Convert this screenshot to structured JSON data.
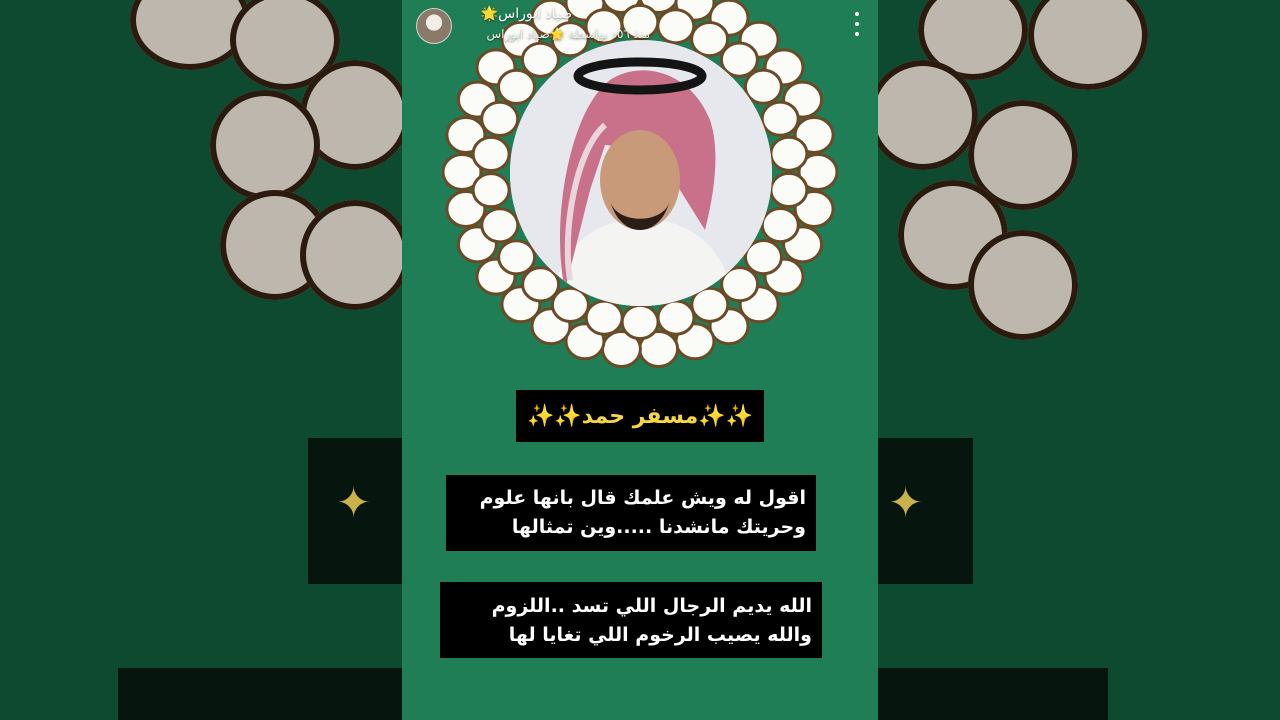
{
  "header": {
    "username": "صياد ابوراس🌟",
    "subline": "منذ ٥٦د بواسطة 🌟صياد ابوراس"
  },
  "card": {
    "name": "✨✨مسفر حمد✨✨"
  },
  "verses": [
    {
      "line1": "اقول له ويش علمك قال بانها علوم",
      "line2": "وحريتك مانشدنا .....وين  تمثالها"
    },
    {
      "line1": "الله يديم الرجال اللي تسد ..اللزوم",
      "line2": "والله يصيب الرخوم اللي تغايا لها"
    }
  ],
  "icons": {
    "menu": "more-vertical-icon",
    "avatar": "avatar"
  },
  "colors": {
    "story_bg": "#1f7e56",
    "name_text": "#f6d646",
    "sparkle": "#c9b24a"
  }
}
